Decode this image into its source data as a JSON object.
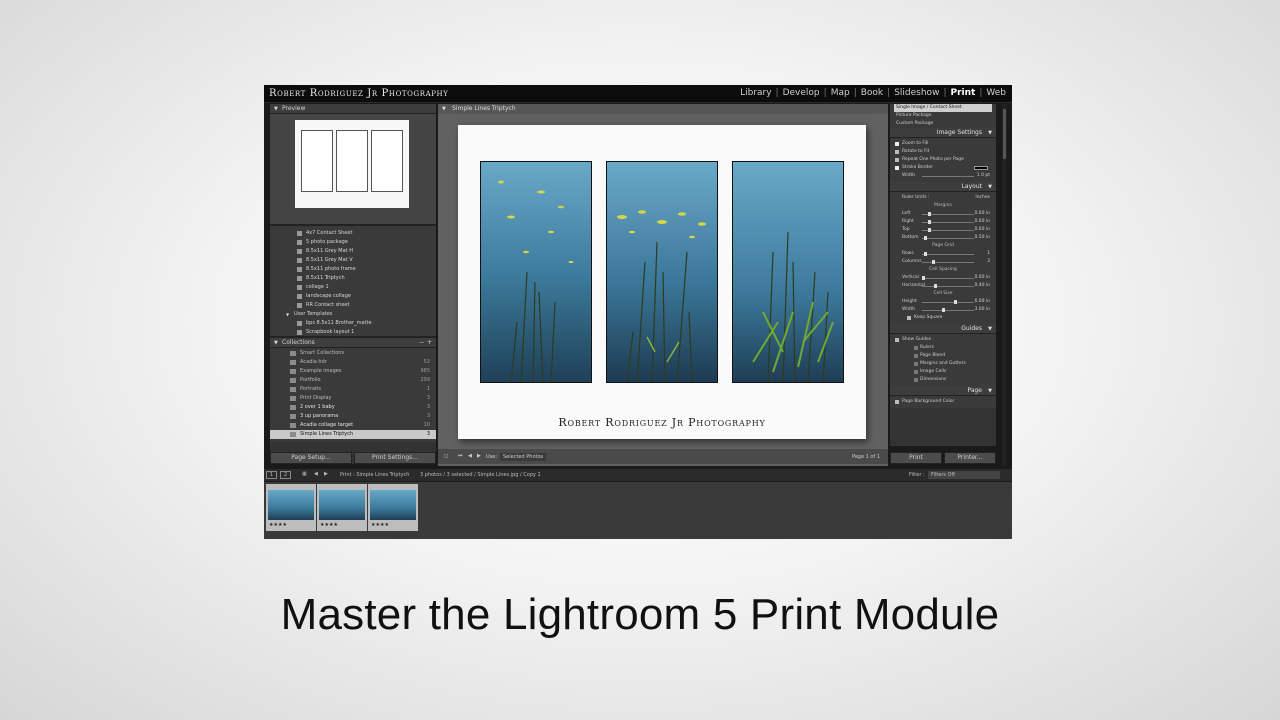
{
  "identity_plate": "Robert Rodriguez Jr Photography",
  "modules": [
    {
      "label": "Library",
      "active": false
    },
    {
      "label": "Develop",
      "active": false
    },
    {
      "label": "Map",
      "active": false
    },
    {
      "label": "Book",
      "active": false
    },
    {
      "label": "Slideshow",
      "active": false
    },
    {
      "label": "Print",
      "active": true
    },
    {
      "label": "Web",
      "active": false
    }
  ],
  "left": {
    "preview_header": "Preview",
    "templates": [
      {
        "label": "4x7 Contact Sheet",
        "type": "item"
      },
      {
        "label": "5 photo package",
        "type": "item"
      },
      {
        "label": "8.5x11 Grey Mat H",
        "type": "item"
      },
      {
        "label": "8.5x11 Grey Mat V",
        "type": "item"
      },
      {
        "label": "8.5x11 photo frame",
        "type": "item"
      },
      {
        "label": "8.5x11 Triptych",
        "type": "item"
      },
      {
        "label": "collage 1",
        "type": "item"
      },
      {
        "label": "landscape collage",
        "type": "item"
      },
      {
        "label": "RR Contact sheet",
        "type": "item"
      },
      {
        "label": "User Templates",
        "type": "folder"
      },
      {
        "label": "bps 8.5x11 Brother_matte",
        "type": "item"
      },
      {
        "label": "Scrapbook layout 1",
        "type": "item"
      }
    ],
    "collections_header": "Collections",
    "collections": [
      {
        "label": "Smart Collections",
        "count": "",
        "selected": false,
        "bold": false
      },
      {
        "label": "Acadia hdr",
        "count": "52",
        "selected": false,
        "bold": false
      },
      {
        "label": "Example images",
        "count": "985",
        "selected": false,
        "bold": false
      },
      {
        "label": "Portfolio",
        "count": "299",
        "selected": false,
        "bold": false
      },
      {
        "label": "Portraits",
        "count": "1",
        "selected": false,
        "bold": false
      },
      {
        "label": "Print Display",
        "count": "3",
        "selected": false,
        "bold": false
      },
      {
        "label": "2 over 1 baby",
        "count": "3",
        "selected": false,
        "bold": true
      },
      {
        "label": "3 up panorama",
        "count": "3",
        "selected": false,
        "bold": true
      },
      {
        "label": "Acadia collage target",
        "count": "10",
        "selected": false,
        "bold": true
      },
      {
        "label": "Simple Lines Triptych",
        "count": "3",
        "selected": true,
        "bold": false
      }
    ],
    "page_setup_label": "Page Setup...",
    "print_settings_label": "Print Settings..."
  },
  "center": {
    "header": "Simple Lines Triptych",
    "caption": "Robert Rodriguez Jr Photography",
    "use_label": "Use:",
    "use_value": "Selected Photos",
    "page_indicator": "Page 1 of 1"
  },
  "right": {
    "layout_styles": [
      "Single Image / Contact Sheet",
      "Picture Package",
      "Custom Package"
    ],
    "image_settings_header": "Image Settings",
    "image_settings": [
      {
        "label": "Zoom to Fill",
        "checked": true
      },
      {
        "label": "Rotate to Fit",
        "checked": false
      },
      {
        "label": "Repeat One Photo per Page",
        "checked": false
      },
      {
        "label": "Stroke Border",
        "checked": true
      }
    ],
    "stroke_width_label": "Width",
    "stroke_width_value": "1.0 pt",
    "layout_header": "Layout",
    "ruler_units_label": "Ruler Units :",
    "ruler_units_value": "Inches",
    "margins_label": "Margins",
    "margins": [
      {
        "label": "Left",
        "value": "0.60 in"
      },
      {
        "label": "Right",
        "value": "0.60 in"
      },
      {
        "label": "Top",
        "value": "0.60 in"
      },
      {
        "label": "Bottom",
        "value": "0.50 in"
      }
    ],
    "page_grid_label": "Page Grid",
    "page_grid": [
      {
        "label": "Rows",
        "value": "1"
      },
      {
        "label": "Columns",
        "value": "3"
      }
    ],
    "cell_spacing_label": "Cell Spacing",
    "cell_spacing": [
      {
        "label": "Vertical",
        "value": "0.00 in"
      },
      {
        "label": "Horizontal",
        "value": "0.40 in"
      }
    ],
    "cell_size_label": "Cell Size",
    "cell_size": [
      {
        "label": "Height",
        "value": "6.00 in"
      },
      {
        "label": "Width",
        "value": "3.00 in"
      }
    ],
    "keep_square": "Keep Square",
    "guides_header": "Guides",
    "guides": [
      {
        "label": "Show Guides",
        "checked": false
      },
      {
        "label": "Rulers",
        "checked": true
      },
      {
        "label": "Page Bleed",
        "checked": true
      },
      {
        "label": "Margins and Gutters",
        "checked": true
      },
      {
        "label": "Image Cells",
        "checked": true
      },
      {
        "label": "Dimensions",
        "checked": true
      }
    ],
    "page_header": "Page",
    "page_bg_label": "Page Background Color",
    "print_label": "Print",
    "printer_label": "Printer..."
  },
  "filmstrip": {
    "view1": "1",
    "view2": "2",
    "path": "Print : Simple Lines Triptych",
    "count": "3 photos / 3 selected / Simple Lines.jpg / Copy 1",
    "filter_label": "Filter :",
    "filter_value": "Filters Off",
    "thumb_stars": [
      "★★★★",
      "★★★★",
      "★★★★"
    ]
  },
  "title": "Master the Lightroom 5 Print Module",
  "colors": {
    "water_top": "#5f9fbf",
    "water_bottom": "#1f3f56",
    "reed": "#2e3b1c",
    "lily": "#d8d44a"
  }
}
